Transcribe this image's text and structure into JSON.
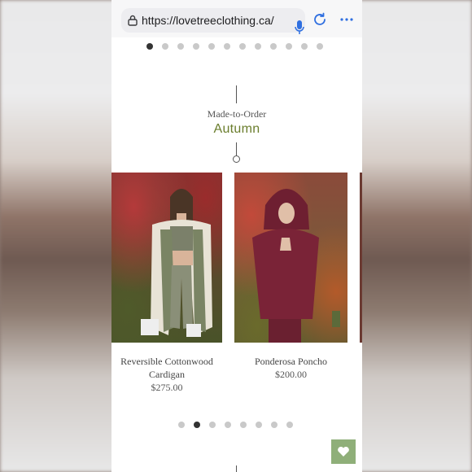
{
  "browser": {
    "url": "https://lovetreeclothing.ca/"
  },
  "carousel_top": {
    "count": 12,
    "active": 0
  },
  "section": {
    "subtitle": "Made-to-Order",
    "title": "Autumn"
  },
  "products": [
    {
      "name_line1": "Reversible Cottonwood",
      "name_line2": "Cardigan",
      "price": "$275.00"
    },
    {
      "name": "Ponderosa Poncho",
      "price": "$200.00"
    }
  ],
  "carousel_bottom": {
    "count": 8,
    "active": 1
  },
  "colors": {
    "accent": "#6a7d2c",
    "favorite_button": "#8faf79"
  },
  "icons": [
    "lock-icon",
    "microphone-icon",
    "reload-icon",
    "more-icon",
    "heart-icon"
  ]
}
